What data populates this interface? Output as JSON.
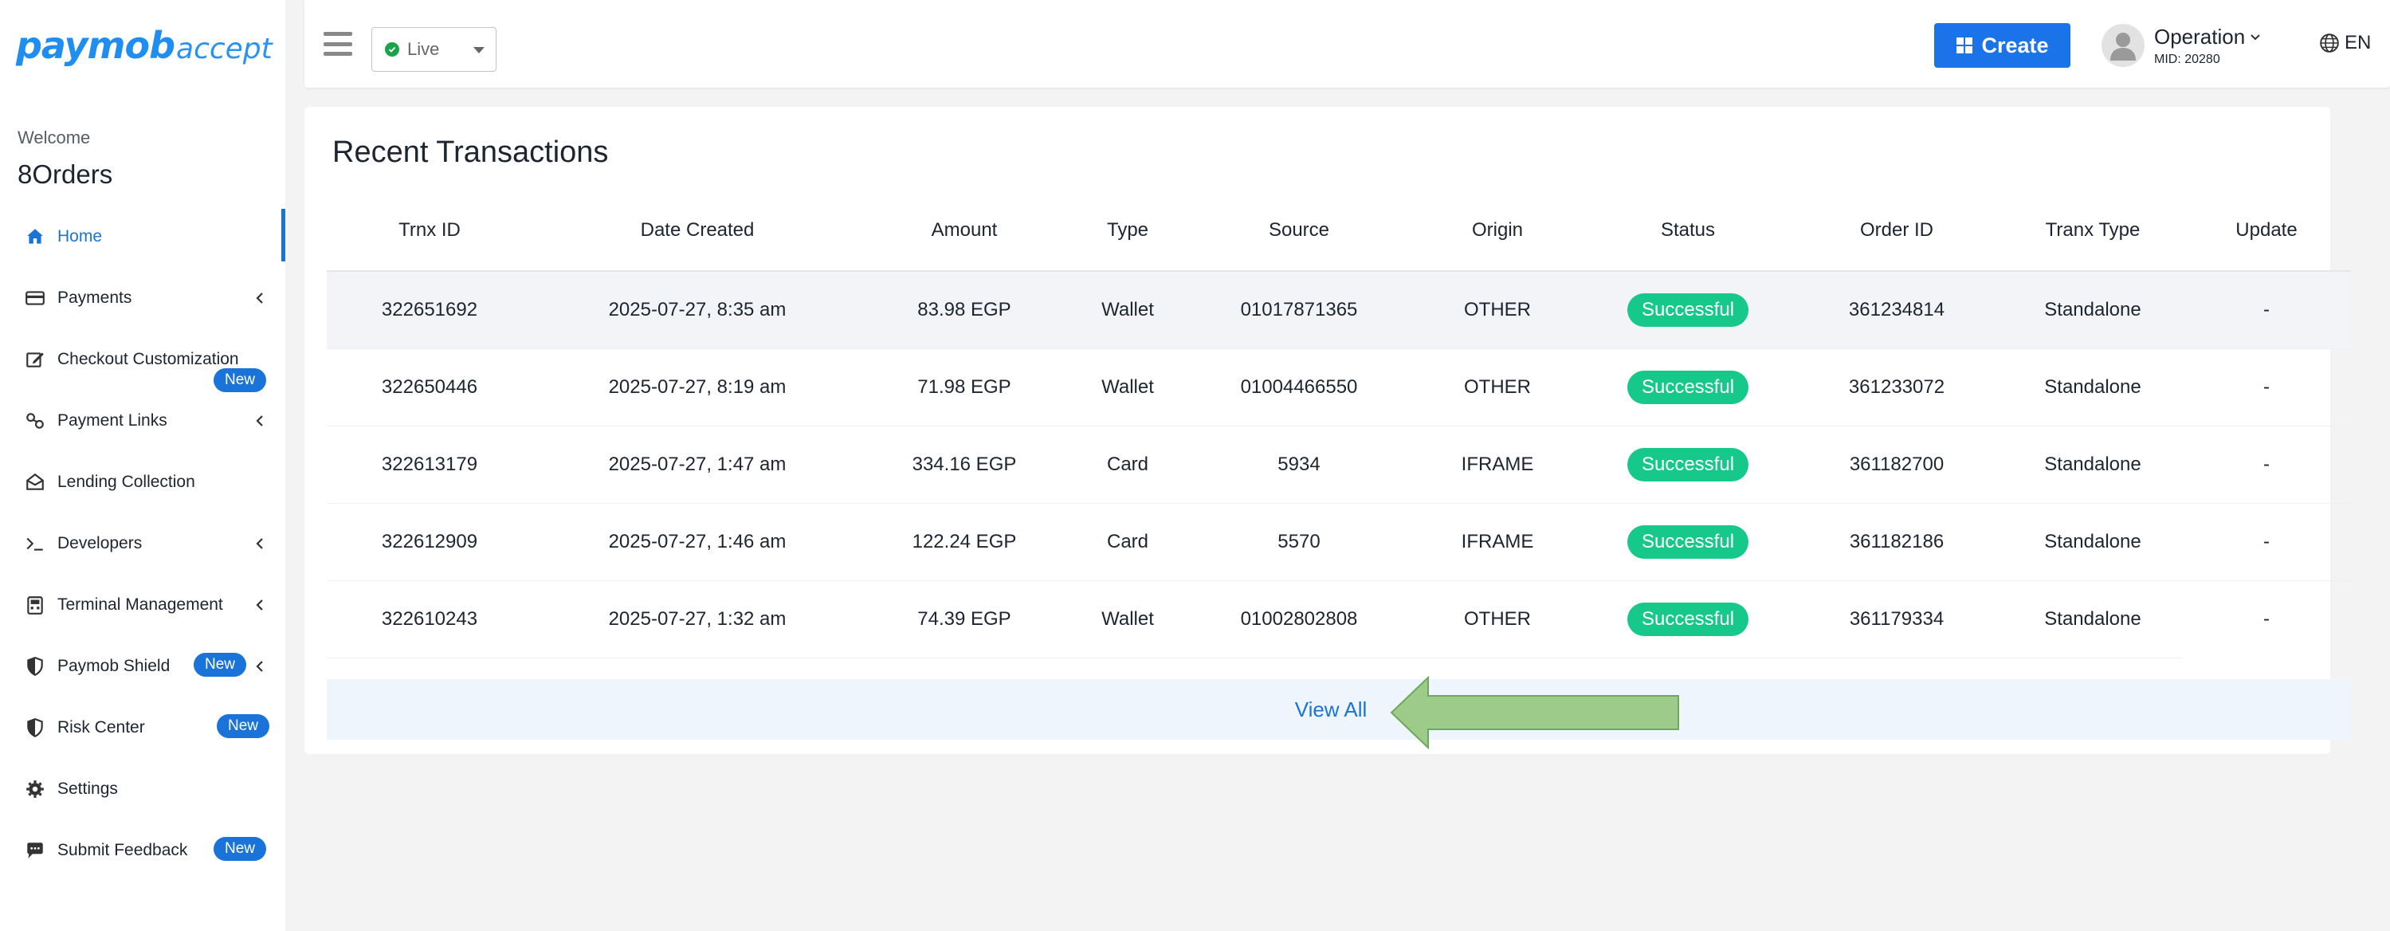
{
  "sidebar": {
    "logo_brand": "paymob",
    "logo_sub": "accept",
    "welcome": "Welcome",
    "merchant": "8Orders",
    "items": [
      {
        "label": "Home",
        "icon": "home-icon"
      },
      {
        "label": "Payments",
        "icon": "card-icon"
      },
      {
        "label": "Checkout Customization",
        "icon": "edit-icon",
        "badge": "New"
      },
      {
        "label": "Payment Links",
        "icon": "link-icon"
      },
      {
        "label": "Lending Collection",
        "icon": "envelope-icon"
      },
      {
        "label": "Developers",
        "icon": "terminal-icon"
      },
      {
        "label": "Terminal Management",
        "icon": "pos-icon"
      },
      {
        "label": "Paymob Shield",
        "icon": "shield-icon",
        "badge": "New"
      },
      {
        "label": "Risk Center",
        "icon": "shield-icon",
        "badge": "New"
      },
      {
        "label": "Settings",
        "icon": "gear-icon"
      },
      {
        "label": "Submit Feedback",
        "icon": "chat-icon",
        "badge": "New"
      }
    ]
  },
  "topbar": {
    "mode": "Live",
    "create_label": "Create",
    "user_name": "Operation",
    "user_mid": "MID: 20280",
    "language": "EN"
  },
  "transactions": {
    "title": "Recent Transactions",
    "columns": [
      "Trnx ID",
      "Date Created",
      "Amount",
      "Type",
      "Source",
      "Origin",
      "Status",
      "Order ID",
      "Tranx Type",
      "Update"
    ],
    "rows": [
      [
        "322651692",
        "2025-07-27, 8:35 am",
        "83.98 EGP",
        "Wallet",
        "01017871365",
        "OTHER",
        "Successful",
        "361234814",
        "Standalone",
        "-"
      ],
      [
        "322650446",
        "2025-07-27, 8:19 am",
        "71.98 EGP",
        "Wallet",
        "01004466550",
        "OTHER",
        "Successful",
        "361233072",
        "Standalone",
        "-"
      ],
      [
        "322613179",
        "2025-07-27, 1:47 am",
        "334.16 EGP",
        "Card",
        "5934",
        "IFRAME",
        "Successful",
        "361182700",
        "Standalone",
        "-"
      ],
      [
        "322612909",
        "2025-07-27, 1:46 am",
        "122.24 EGP",
        "Card",
        "5570",
        "IFRAME",
        "Successful",
        "361182186",
        "Standalone",
        "-"
      ],
      [
        "322610243",
        "2025-07-27, 1:32 am",
        "74.39 EGP",
        "Wallet",
        "01002802808",
        "OTHER",
        "Successful",
        "361179334",
        "Standalone",
        "-"
      ]
    ],
    "view_all": "View All"
  },
  "colors": {
    "accent": "#1a73e8",
    "success": "#16c98a",
    "arrow": "#9ccb8a"
  }
}
